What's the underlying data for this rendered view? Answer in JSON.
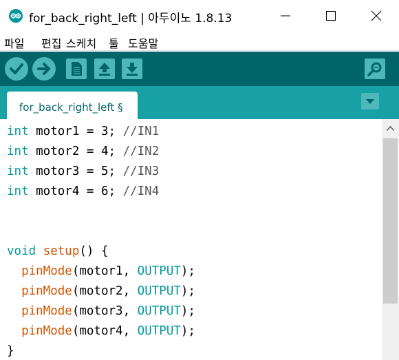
{
  "window": {
    "title": "for_back_right_left | 아두이노 1.8.13"
  },
  "menu": [
    "파일",
    "편집",
    "스케치",
    "툴",
    "도움말"
  ],
  "toolbar": {
    "buttons": [
      "verify-icon",
      "upload-icon",
      "new-icon",
      "open-icon",
      "save-icon",
      "serial-monitor-icon"
    ]
  },
  "tabs": [
    {
      "label": "for_back_right_left §"
    }
  ],
  "code": [
    [
      {
        "t": "int",
        "c": "kw"
      },
      {
        "t": " motor1 = 3; ",
        "c": ""
      },
      {
        "t": "//IN1",
        "c": "cm"
      }
    ],
    [
      {
        "t": "int",
        "c": "kw"
      },
      {
        "t": " motor2 = 4; ",
        "c": ""
      },
      {
        "t": "//IN2",
        "c": "cm"
      }
    ],
    [
      {
        "t": "int",
        "c": "kw"
      },
      {
        "t": " motor3 = 5; ",
        "c": ""
      },
      {
        "t": "//IN3",
        "c": "cm"
      }
    ],
    [
      {
        "t": "int",
        "c": "kw"
      },
      {
        "t": " motor4 = 6; ",
        "c": ""
      },
      {
        "t": "//IN4",
        "c": "cm"
      }
    ],
    [],
    [],
    [
      {
        "t": "void",
        "c": "kw"
      },
      {
        "t": " ",
        "c": ""
      },
      {
        "t": "setup",
        "c": "fn"
      },
      {
        "t": "() {",
        "c": ""
      }
    ],
    [
      {
        "t": "  ",
        "c": ""
      },
      {
        "t": "pinMode",
        "c": "fn"
      },
      {
        "t": "(motor1, ",
        "c": ""
      },
      {
        "t": "OUTPUT",
        "c": "const"
      },
      {
        "t": ");",
        "c": ""
      }
    ],
    [
      {
        "t": "  ",
        "c": ""
      },
      {
        "t": "pinMode",
        "c": "fn"
      },
      {
        "t": "(motor2, ",
        "c": ""
      },
      {
        "t": "OUTPUT",
        "c": "const"
      },
      {
        "t": ");",
        "c": ""
      }
    ],
    [
      {
        "t": "  ",
        "c": ""
      },
      {
        "t": "pinMode",
        "c": "fn"
      },
      {
        "t": "(motor3, ",
        "c": ""
      },
      {
        "t": "OUTPUT",
        "c": "const"
      },
      {
        "t": ");",
        "c": ""
      }
    ],
    [
      {
        "t": "  ",
        "c": ""
      },
      {
        "t": "pinMode",
        "c": "fn"
      },
      {
        "t": "(motor4, ",
        "c": ""
      },
      {
        "t": "OUTPUT",
        "c": "const"
      },
      {
        "t": ");",
        "c": ""
      }
    ],
    [
      {
        "t": "}",
        "c": ""
      }
    ]
  ],
  "colors": {
    "toolbar": "#006468",
    "tabbar": "#17a1a5",
    "button": "#4db7bb",
    "keyword": "#00979c",
    "function": "#d35400"
  }
}
